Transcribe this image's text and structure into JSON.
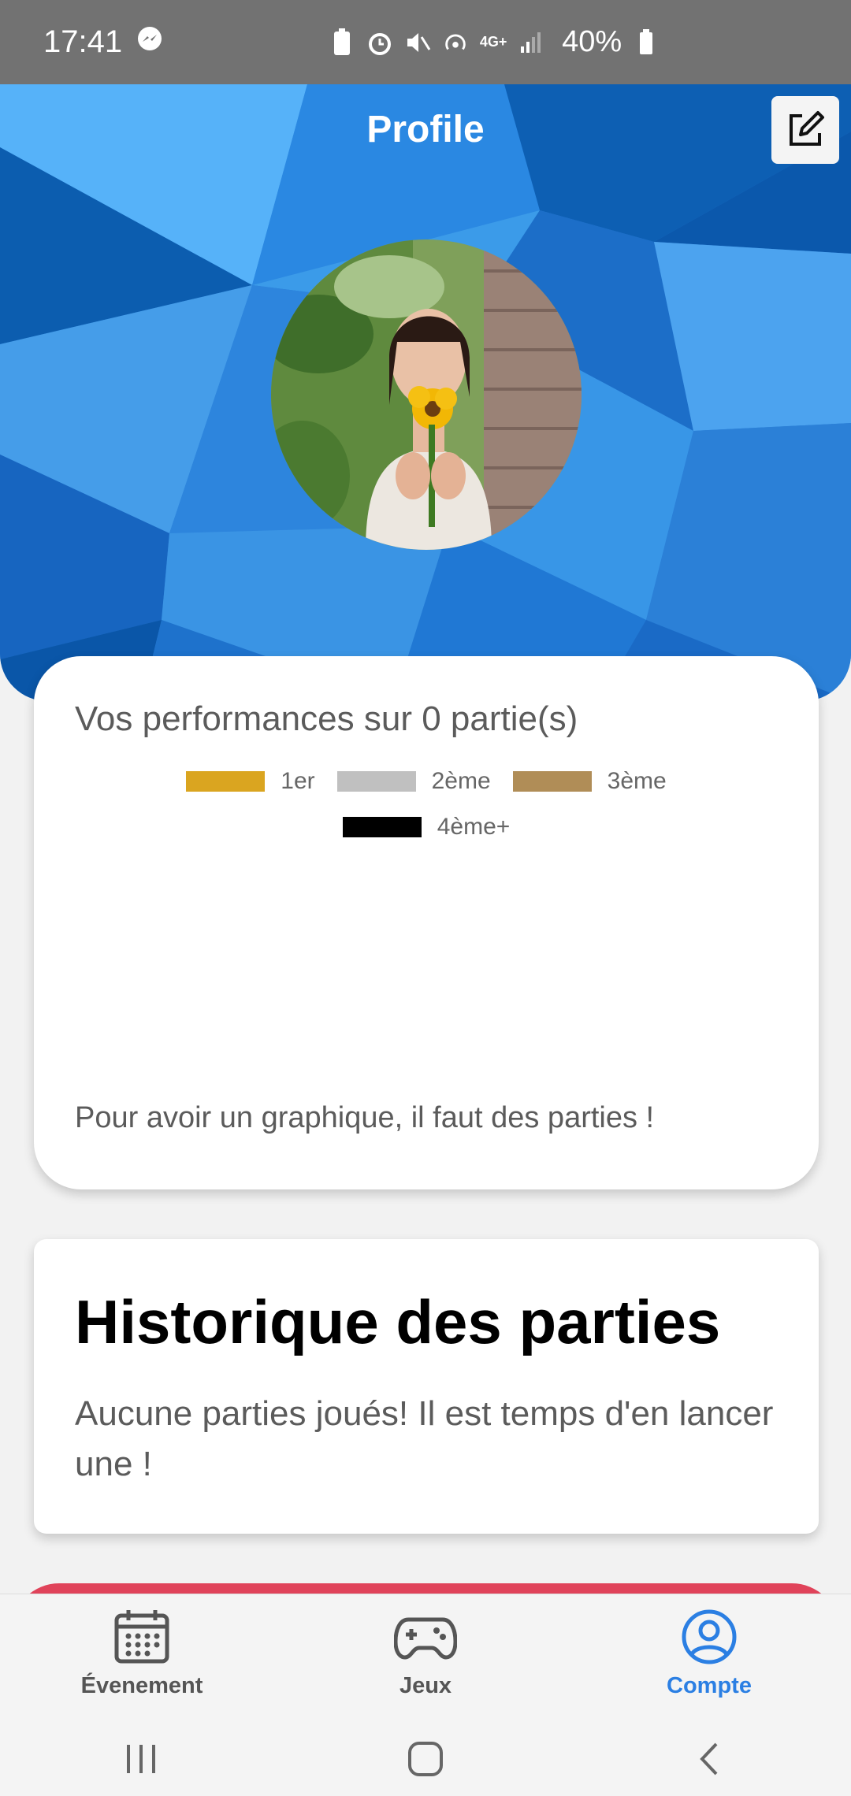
{
  "status_bar": {
    "time": "17:41",
    "battery": "40%",
    "network": "4G+"
  },
  "header": {
    "title": "Profile"
  },
  "performance": {
    "title": "Vos performances sur 0 partie(s)",
    "legend": [
      {
        "label": "1er",
        "color": "#DAA520"
      },
      {
        "label": "2ème",
        "color": "#C0C0C0"
      },
      {
        "label": "3ème",
        "color": "#B08D57"
      },
      {
        "label": "4ème+",
        "color": "#000000"
      }
    ],
    "empty_message": "Pour avoir un graphique, il faut des parties !"
  },
  "history": {
    "title": "Historique des parties",
    "empty_message": "Aucune parties joués! Il est temps d'en lancer une !"
  },
  "bottom_nav": {
    "items": [
      {
        "label": "Évenement",
        "icon": "calendar-icon"
      },
      {
        "label": "Jeux",
        "icon": "gamepad-icon"
      },
      {
        "label": "Compte",
        "icon": "account-icon",
        "active": true
      }
    ],
    "active_color": "#2B7FE3"
  },
  "colors": {
    "header_blue": "#2B7FD6",
    "accent_red": "#E0435A"
  }
}
